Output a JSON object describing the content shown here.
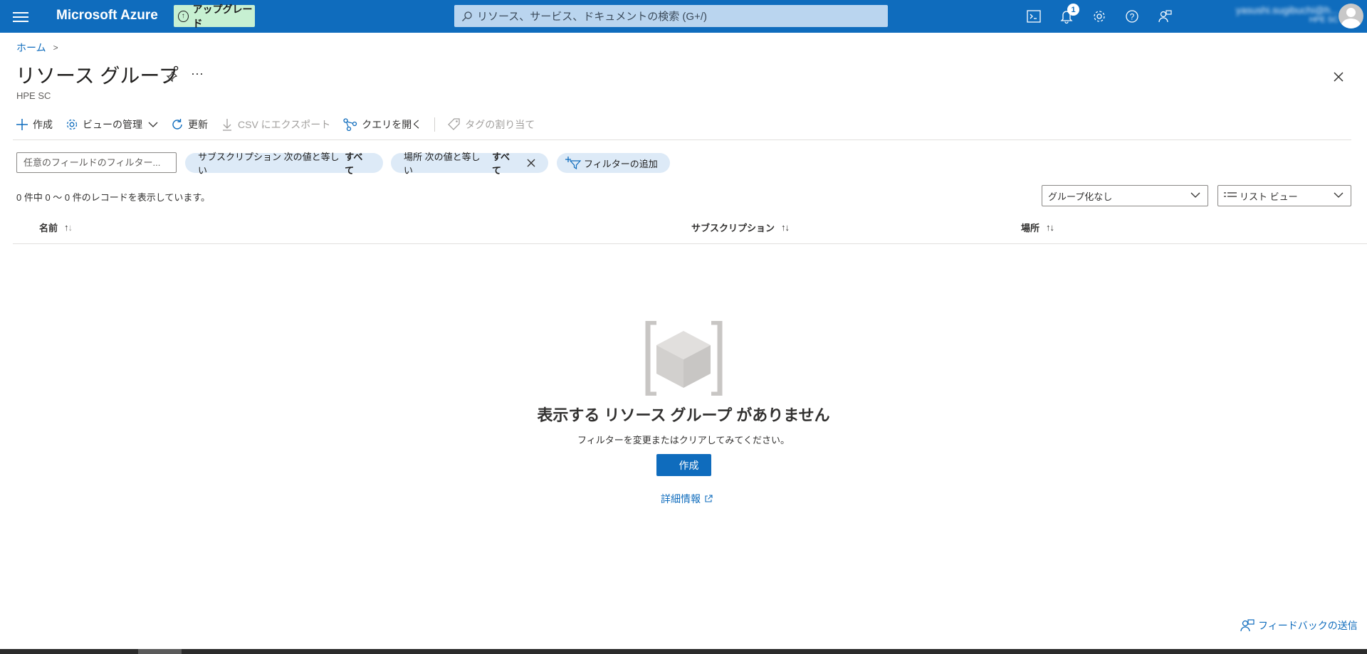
{
  "topbar": {
    "brand": "Microsoft Azure",
    "upgrade_label": "アップグレード",
    "search_placeholder": "リソース、サービス、ドキュメントの検索 (G+/)",
    "notification_count": "1",
    "account_name": "yasushi.sugibuchi@h...",
    "account_directory": "HPE SC",
    "icons": [
      "cloud-shell-icon",
      "bell-icon",
      "gear-icon",
      "help-icon",
      "feedback-icon"
    ]
  },
  "breadcrumb": {
    "home": "ホーム"
  },
  "page": {
    "title": "リソース グループ",
    "subtitle": "HPE SC"
  },
  "toolbar": {
    "create": "作成",
    "manage_view": "ビューの管理",
    "refresh": "更新",
    "export_csv": "CSV にエクスポート",
    "open_query": "クエリを開く",
    "assign_tags": "タグの割り当て"
  },
  "filters": {
    "field_filter_placeholder": "任意のフィールドのフィルター...",
    "subscription_pill": {
      "label": "サブスクリプション 次の値と等しい",
      "value": "すべて"
    },
    "location_pill": {
      "label": "場所 次の値と等しい",
      "value": "すべて"
    },
    "add_filter": "フィルターの追加"
  },
  "records_text": "0 件中 0 ～ 0 件のレコードを表示しています。",
  "grouping": {
    "selected": "グループ化なし"
  },
  "view": {
    "selected": "リスト ビュー"
  },
  "table": {
    "columns": [
      "名前",
      "サブスクリプション",
      "場所"
    ]
  },
  "empty_state": {
    "title": "表示する リソース グループ がありません",
    "subtitle": "フィルターを変更またはクリアしてみてください。",
    "create_button": "作成",
    "learn_more": "詳細情報"
  },
  "feedback": "フィードバックの送信",
  "colors": {
    "accent": "#0f6cbd",
    "upgrade_bg": "#c7f0d2",
    "pill_bg": "#ddeaf7"
  }
}
